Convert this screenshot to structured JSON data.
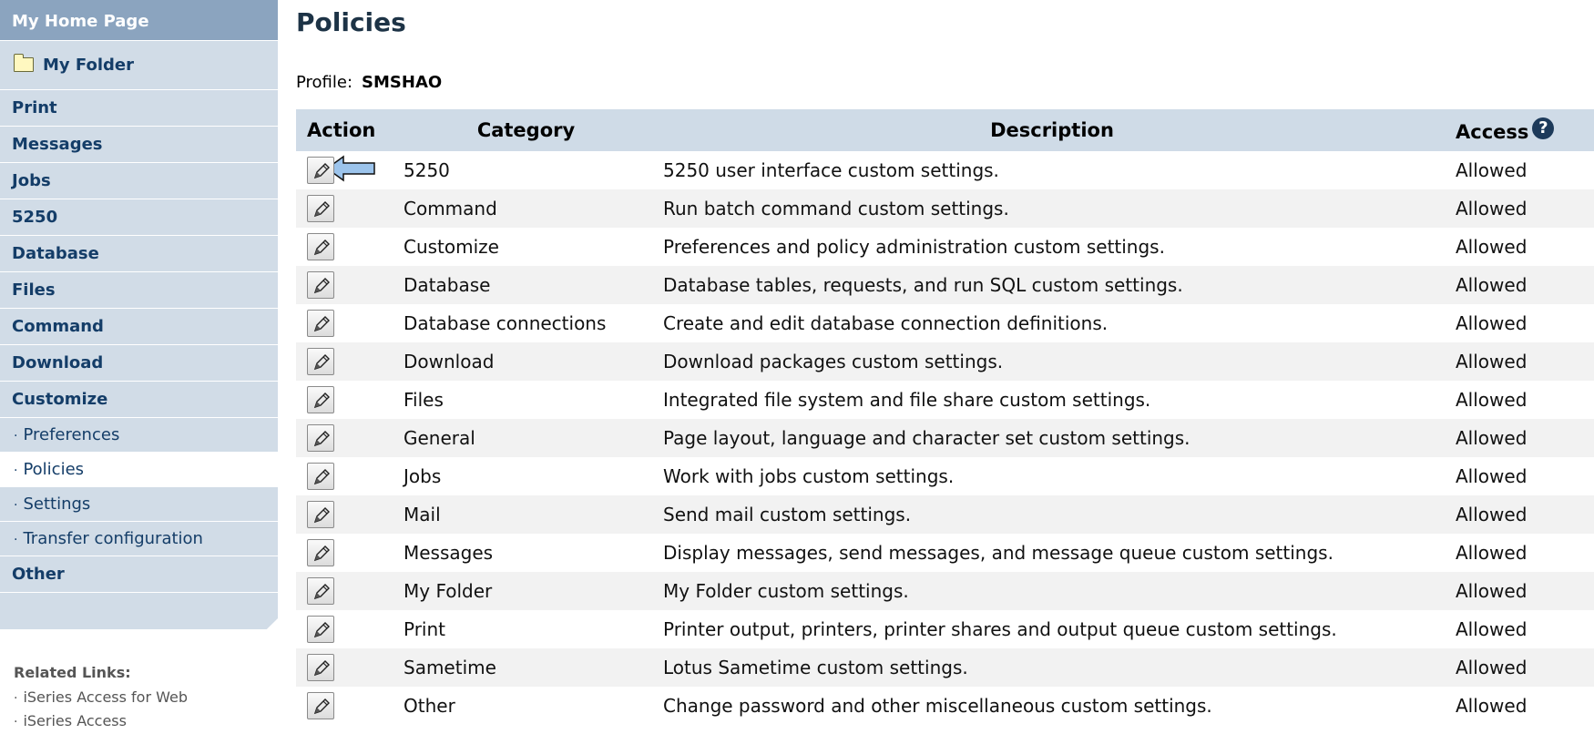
{
  "sidebar": {
    "home": "My Home Page",
    "folder": "My Folder",
    "items": [
      "Print",
      "Messages",
      "Jobs",
      "5250",
      "Database",
      "Files",
      "Command",
      "Download",
      "Customize"
    ],
    "sub_items": [
      "Preferences",
      "Policies",
      "Settings",
      "Transfer configuration"
    ],
    "other": "Other",
    "active_sub_item": "Policies"
  },
  "related": {
    "title": "Related Links:",
    "links": [
      "iSeries Access for Web",
      "iSeries Access"
    ]
  },
  "page": {
    "title": "Policies",
    "profile_label": "Profile:",
    "profile_value": "SMSHAO"
  },
  "table": {
    "headers": {
      "action": "Action",
      "category": "Category",
      "description": "Description",
      "access": "Access"
    },
    "rows": [
      {
        "category": "5250",
        "description": "5250 user interface custom settings.",
        "access": "Allowed"
      },
      {
        "category": "Command",
        "description": "Run batch command custom settings.",
        "access": "Allowed"
      },
      {
        "category": "Customize",
        "description": "Preferences and policy administration custom settings.",
        "access": "Allowed"
      },
      {
        "category": "Database",
        "description": "Database tables, requests, and run SQL custom settings.",
        "access": "Allowed"
      },
      {
        "category": "Database connections",
        "description": "Create and edit database connection definitions.",
        "access": "Allowed"
      },
      {
        "category": "Download",
        "description": "Download packages custom settings.",
        "access": "Allowed"
      },
      {
        "category": "Files",
        "description": "Integrated file system and file share custom settings.",
        "access": "Allowed"
      },
      {
        "category": "General",
        "description": "Page layout, language and character set custom settings.",
        "access": "Allowed"
      },
      {
        "category": "Jobs",
        "description": "Work with jobs custom settings.",
        "access": "Allowed"
      },
      {
        "category": "Mail",
        "description": "Send mail custom settings.",
        "access": "Allowed"
      },
      {
        "category": "Messages",
        "description": "Display messages, send messages, and message queue custom settings.",
        "access": "Allowed"
      },
      {
        "category": "My Folder",
        "description": "My Folder custom settings.",
        "access": "Allowed"
      },
      {
        "category": "Print",
        "description": "Printer output, printers, printer shares and output queue custom settings.",
        "access": "Allowed"
      },
      {
        "category": "Sametime",
        "description": "Lotus Sametime custom settings.",
        "access": "Allowed"
      },
      {
        "category": "Other",
        "description": "Change password and other miscellaneous custom settings.",
        "access": "Allowed"
      }
    ]
  },
  "icons": {
    "edit": "pencil-icon",
    "help": "help-icon",
    "folder": "folder-icon",
    "arrow": "arrow-left-icon"
  },
  "colors": {
    "nav_bg": "#d1dce7",
    "nav_home_bg": "#8ba4bf",
    "nav_text": "#143d68",
    "header_bg": "#cfdbe7",
    "row_alt": "#f2f2f2"
  }
}
